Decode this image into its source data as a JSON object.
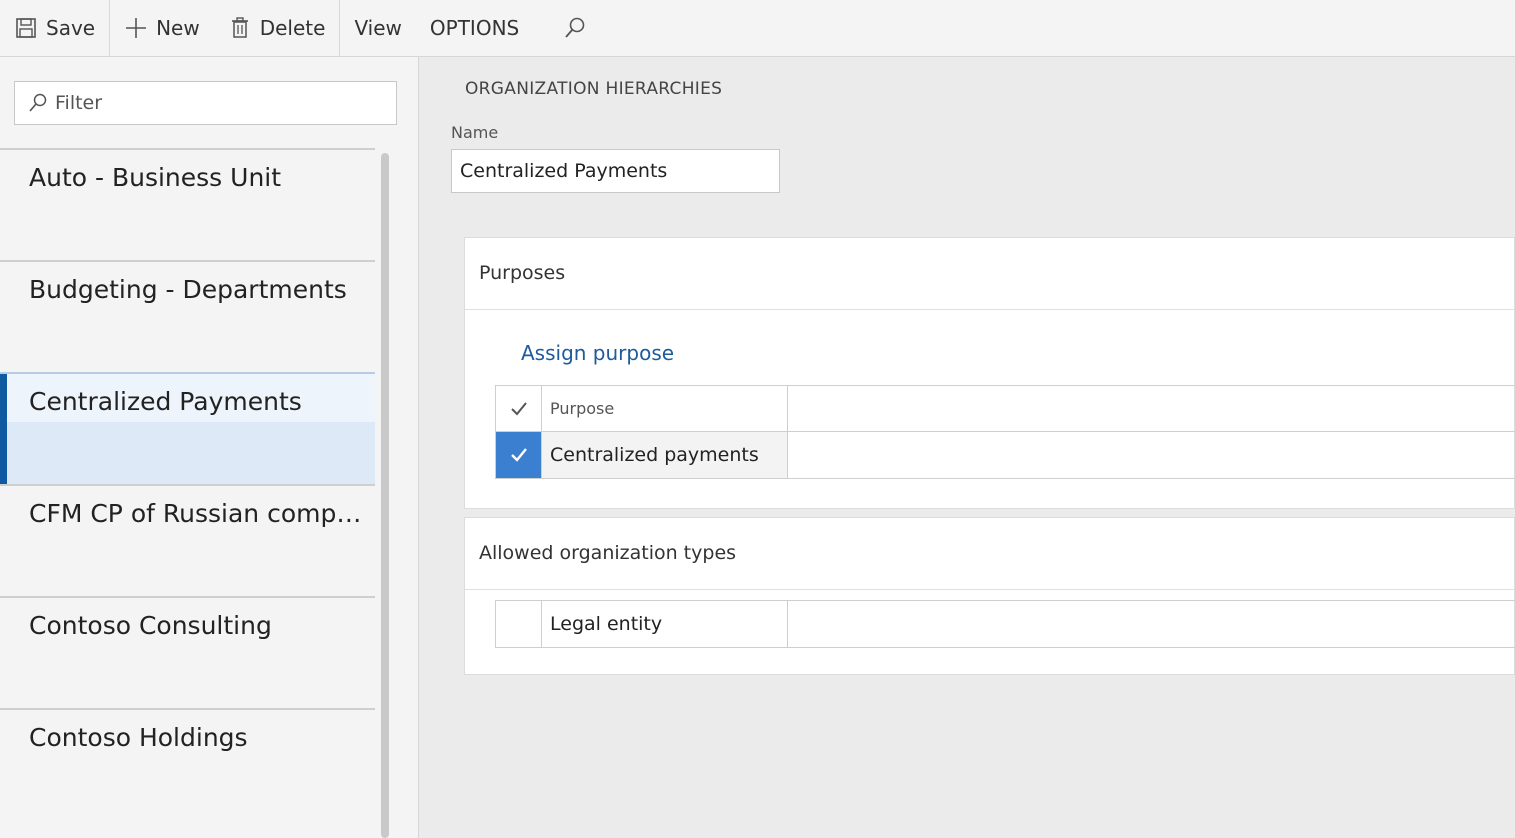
{
  "toolbar": {
    "save_label": "Save",
    "new_label": "New",
    "delete_label": "Delete",
    "view_label": "View",
    "options_label": "OPTIONS"
  },
  "filter": {
    "placeholder": "Filter"
  },
  "list": {
    "items": [
      {
        "label": "Auto - Business Unit"
      },
      {
        "label": "Budgeting - Departments"
      },
      {
        "label": "Centralized Payments"
      },
      {
        "label": "CFM CP of Russian compa..."
      },
      {
        "label": "Contoso Consulting"
      },
      {
        "label": "Contoso Holdings"
      }
    ]
  },
  "main": {
    "section_title": "ORGANIZATION HIERARCHIES",
    "name_label": "Name",
    "name_value": "Centralized Payments",
    "purposes": {
      "title": "Purposes",
      "assign_link": "Assign purpose",
      "column_header": "Purpose",
      "rows": [
        {
          "value": "Centralized payments",
          "checked": true
        }
      ]
    },
    "allowed_types": {
      "title": "Allowed organization types",
      "rows": [
        {
          "value": "Legal entity",
          "checked": false
        }
      ]
    }
  },
  "colors": {
    "accent": "#0f5aa0",
    "check_bg": "#3b7fd1",
    "link": "#1e5a9c",
    "selected_bg": "#dde9f6"
  }
}
